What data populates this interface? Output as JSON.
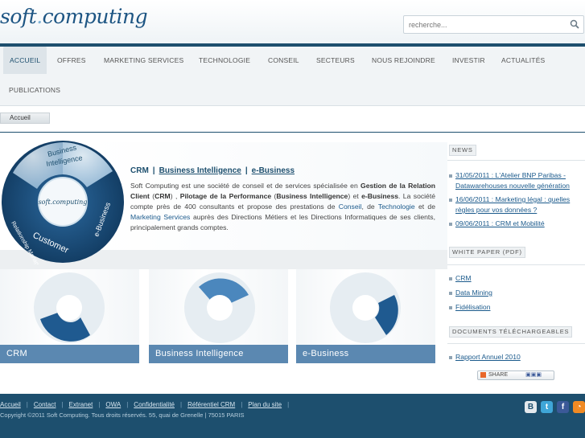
{
  "header": {
    "logo_part1": "soft",
    "logo_dot": ".",
    "logo_part2": "computing",
    "search_placeholder": "recherche..."
  },
  "nav": {
    "items": [
      "ACCUEIL",
      "OFFRES",
      "MARKETING SERVICES",
      "TECHNOLOGIE",
      "CONSEIL",
      "SECTEURS",
      "NOUS REJOINDRE",
      "INVESTIR",
      "ACTUALITÉS",
      "PUBLICATIONS"
    ]
  },
  "breadcrumb": "Accueil",
  "intro": {
    "links": [
      "CRM",
      "Business Intelligence",
      "e-Business"
    ],
    "separator": "|",
    "text_1": "Soft Computing est une société de conseil et de services spécialisée en ",
    "bold_1": "Gestion de la Relation Client",
    "text_2": " (",
    "bold_crm": "CRM",
    "text_3": ") , ",
    "bold_2": "Pilotage de la Performance",
    "text_4": " (",
    "bold_bi": "Business Intelligence",
    "text_5": ") et ",
    "bold_3": "e-Business",
    "text_6": ". La société compte près de 400 consultants et propose des prestations de ",
    "link_conseil": "Conseil",
    "text_7": ", de ",
    "link_technologie": "Technologie",
    "text_8": " et de ",
    "link_marketing": "Marketing Services",
    "text_9": " auprès des Directions Métiers et les Directions Informatiques de ses clients, principalement grands comptes.",
    "orb_labels": [
      "Business",
      "Intelligence",
      "Customer",
      "Relationship Management",
      "e-Business"
    ],
    "orb_logo": "soft.computing"
  },
  "cards": [
    {
      "label": "CRM"
    },
    {
      "label": "Business Intelligence"
    },
    {
      "label": "e-Business"
    }
  ],
  "sidebar": {
    "news_title": "NEWS",
    "news": [
      "31/05/2011 : L'Atelier BNP Paribas - Datawarehouses nouvelle génération",
      "16/06/2011 : Marketing légal : quelles règles pour vos données ?",
      "09/06/2011 : CRM et Mobilité"
    ],
    "white_paper_title": "WHITE PAPER (PDF)",
    "white_papers": [
      "CRM",
      "Data Mining",
      "Fidélisation"
    ],
    "downloads_title": "DOCUMENTS TÉLÉCHARGEABLES",
    "downloads": [
      "Rapport Annuel 2010"
    ],
    "share_label": "SHARE"
  },
  "footer": {
    "links": [
      "Accueil",
      "Contact",
      "Extranet",
      "OWA",
      "Confidentialité",
      "Référentiel CRM",
      "Plan du site"
    ],
    "copyright": "Copyright ©2011 Soft Computing. Tous droits réservés. 55, quai de Grenelle | 75015 PARIS",
    "social": [
      "blogger-icon",
      "twitter-icon",
      "facebook-icon",
      "rss-icon"
    ]
  },
  "colors": {
    "brand": "#1d4f6e",
    "card_label": "#5b88b1",
    "link": "#1b5a8c"
  }
}
